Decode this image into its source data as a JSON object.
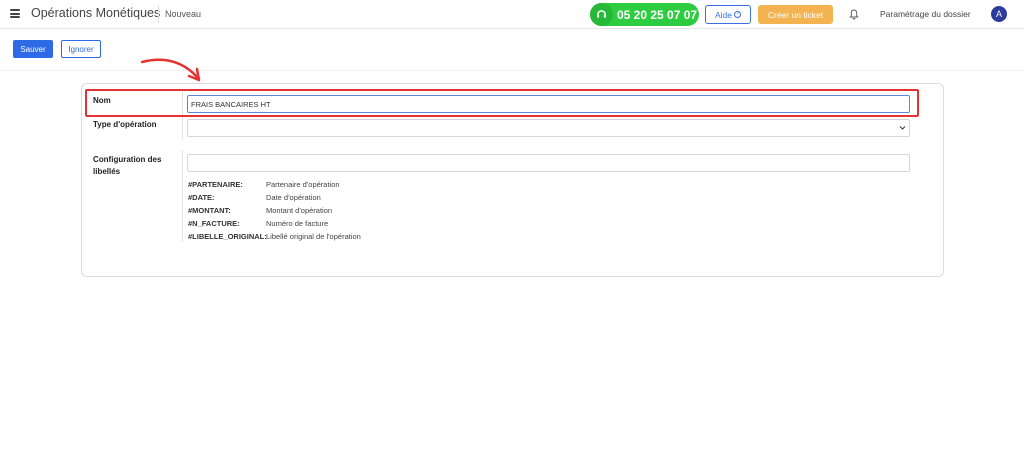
{
  "header": {
    "app_title": "Opérations Monétiques",
    "breadcrumb": "Nouveau",
    "phone": "05 20 25 07 07",
    "help_label": "Aide",
    "help_icon": "question-circle-icon",
    "ticket_label": "Créer un ticket",
    "settings_label": "Paramétrage du dossier",
    "avatar_initial": "A",
    "colors": {
      "phone_badge": "#2ecc40",
      "help": "#3b6fe6",
      "ticket": "#f3b350",
      "avatar": "#2b3c9c"
    }
  },
  "toolbar": {
    "save_label": "Sauver",
    "ignore_label": "Ignorer",
    "primary_color": "#2e6ae6"
  },
  "form": {
    "nom": {
      "label": "Nom",
      "value": "FRAIS BANCAIRES HT"
    },
    "type": {
      "label": "Type d'opération",
      "value": ""
    },
    "config": {
      "label_line1": "Configuration des",
      "label_line2": "libellés",
      "value": "",
      "tokens": [
        {
          "token": "#PARTENAIRE:",
          "desc": "Partenaire d'opération"
        },
        {
          "token": "#DATE:",
          "desc": "Date d'opération"
        },
        {
          "token": "#MONTANT:",
          "desc": "Montant d'opération"
        },
        {
          "token": "#N_FACTURE:",
          "desc": "Numéro de facture"
        },
        {
          "token": "#LIBELLE_ORIGINAL:",
          "desc": "Libellé original de l'opération"
        }
      ]
    }
  },
  "annotation": {
    "highlight_color": "#e63232"
  }
}
